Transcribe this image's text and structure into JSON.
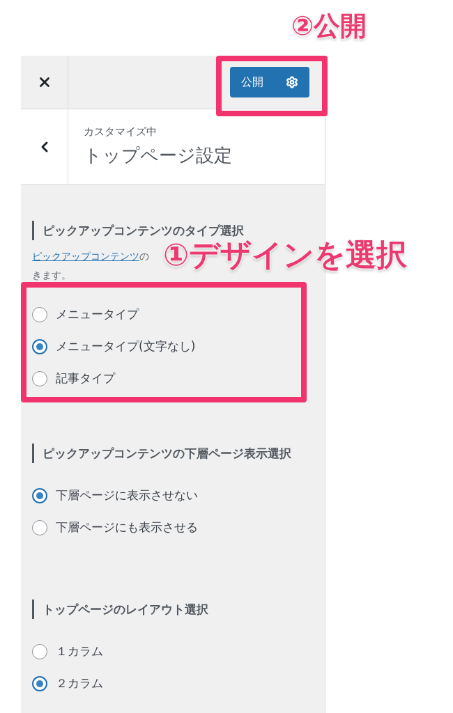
{
  "topbar": {
    "publish_button": "公開"
  },
  "header": {
    "caption": "カスタマイズ中",
    "title": "トップページ設定"
  },
  "sections": [
    {
      "title": "ピックアップコンテンツのタイプ選択",
      "description": {
        "link": "ピックアップコンテンツ",
        "text": "の",
        "continuation": "きます。"
      },
      "options": [
        {
          "label": "メニュータイプ",
          "selected": false
        },
        {
          "label": "メニュータイプ(文字なし)",
          "selected": true
        },
        {
          "label": "記事タイプ",
          "selected": false
        }
      ]
    },
    {
      "title": "ピックアップコンテンツの下層ページ表示選択",
      "options": [
        {
          "label": "下層ページに表示させない",
          "selected": true
        },
        {
          "label": "下層ページにも表示させる",
          "selected": false
        }
      ]
    },
    {
      "title": "トップページのレイアウト選択",
      "options": [
        {
          "label": "１カラム",
          "selected": false
        },
        {
          "label": "２カラム",
          "selected": true
        }
      ]
    }
  ],
  "annotations": [
    {
      "text": "②公開"
    },
    {
      "text": "①デザインを選択"
    }
  ]
}
